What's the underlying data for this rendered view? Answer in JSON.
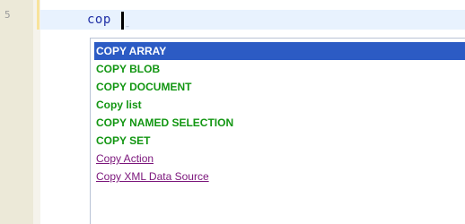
{
  "editor": {
    "line_number": "5",
    "typed_text": "cop",
    "hint_glyph": "–",
    "colors": {
      "gutter": "#ece9d8",
      "current_line": "#e8f2fe",
      "keyword": "#129612",
      "link": "#7b157b",
      "selection": "#2c5bc4"
    }
  },
  "autocomplete": {
    "selected_index": 0,
    "items": [
      {
        "label": "COPY ARRAY",
        "kind": "keyword"
      },
      {
        "label": "COPY BLOB",
        "kind": "keyword"
      },
      {
        "label": "COPY DOCUMENT",
        "kind": "keyword"
      },
      {
        "label": "Copy list",
        "kind": "keyword"
      },
      {
        "label": "COPY NAMED SELECTION",
        "kind": "keyword"
      },
      {
        "label": "COPY SET",
        "kind": "keyword"
      },
      {
        "label": "Copy Action",
        "kind": "link"
      },
      {
        "label": "Copy XML Data Source",
        "kind": "link"
      }
    ]
  }
}
